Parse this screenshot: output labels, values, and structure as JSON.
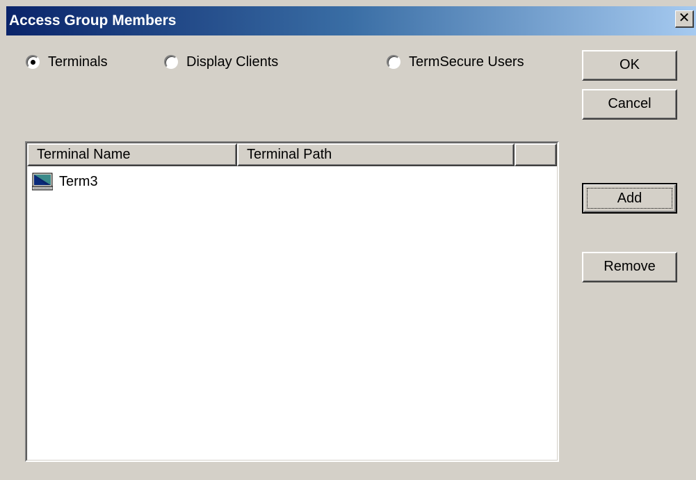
{
  "window": {
    "title": "Access Group Members",
    "close_glyph": "✕"
  },
  "radios": {
    "terminals": {
      "label": "Terminals",
      "checked": true
    },
    "display_clients": {
      "label": "Display Clients",
      "checked": false
    },
    "termsecure_users": {
      "label": "TermSecure Users",
      "checked": false
    }
  },
  "buttons": {
    "ok": "OK",
    "cancel": "Cancel",
    "add": "Add",
    "remove": "Remove"
  },
  "list": {
    "columns": [
      "Terminal Name",
      "Terminal Path",
      ""
    ],
    "rows": [
      {
        "name": "Term3",
        "path": "",
        "icon": "terminal-computer-icon"
      }
    ]
  },
  "colors": {
    "face": "#d4d0c8",
    "title_start": "#0a246a",
    "title_end": "#a6caf0"
  }
}
